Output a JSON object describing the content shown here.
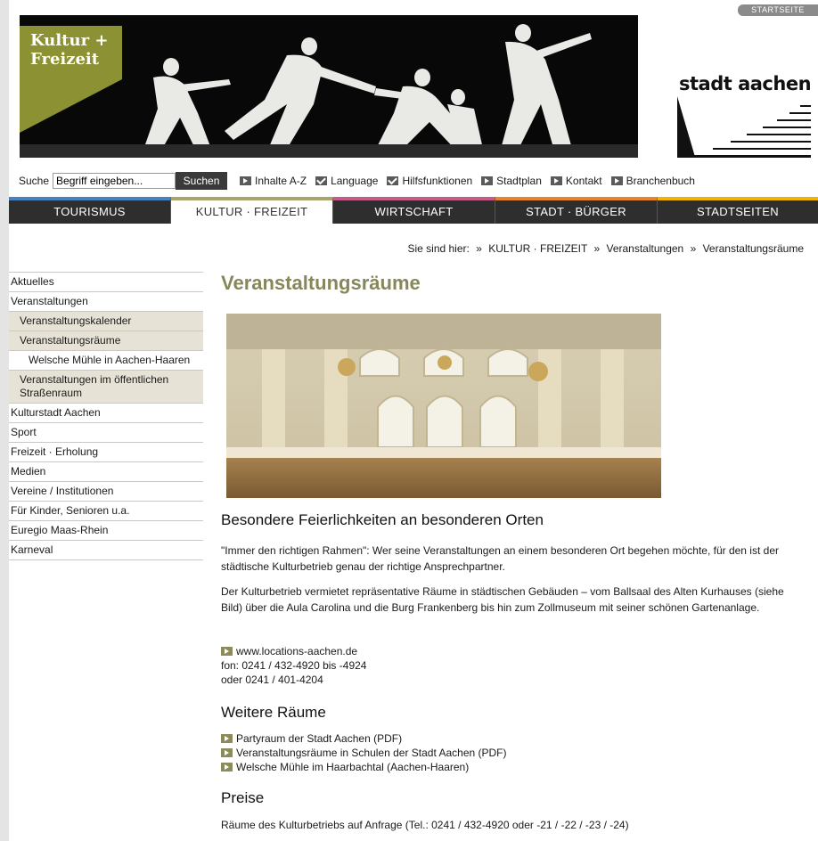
{
  "header": {
    "startseite_label": "STARTSEITE",
    "badge_text_line1": "Kultur +",
    "badge_text_line2": "Freizeit",
    "logo_text": "stadt aachen"
  },
  "toolbar": {
    "search_label": "Suche",
    "search_value": "Begriff eingeben...",
    "search_button": "Suchen",
    "links": [
      {
        "label": "Inhalte A-Z",
        "icon": "arrow-icon"
      },
      {
        "label": "Language",
        "icon": "check-mail-icon"
      },
      {
        "label": "Hilfsfunktionen",
        "icon": "check-mail-icon"
      },
      {
        "label": "Stadtplan",
        "icon": "arrow-icon"
      },
      {
        "label": "Kontakt",
        "icon": "arrow-icon"
      },
      {
        "label": "Branchenbuch",
        "icon": "arrow-icon"
      }
    ]
  },
  "nav": {
    "items": [
      {
        "label": "TOURISMUS",
        "color": "#4a7fc0"
      },
      {
        "label": "KULTUR · FREIZEIT",
        "color": "#a7a66c"
      },
      {
        "label": "WIRTSCHAFT",
        "color": "#c45c88"
      },
      {
        "label": "STADT · BÜRGER",
        "color": "#e8832a"
      },
      {
        "label": "STADTSEITEN",
        "color": "#f0b400"
      }
    ]
  },
  "breadcrumb": {
    "prefix": "Sie sind hier:",
    "items": [
      "KULTUR · FREIZEIT",
      "Veranstaltungen",
      "Veranstaltungsräume"
    ]
  },
  "sidebar": {
    "items": [
      "Aktuelles",
      "Veranstaltungen",
      "Veranstaltungskalender",
      "Veranstaltungsräume",
      "Welsche Mühle in Aachen-Haaren",
      "Veranstaltungen im öffentlichen Straßenraum",
      "Kulturstadt Aachen",
      "Sport",
      "Freizeit · Erholung",
      "Medien",
      "Vereine / Institutionen",
      "Für Kinder, Senioren u.a.",
      "Euregio Maas-Rhein",
      "Karneval"
    ]
  },
  "main": {
    "title": "Veranstaltungsräume",
    "heading1": "Besondere Feierlichkeiten an besonderen Orten",
    "para1": "\"Immer den richtigen Rahmen\": Wer seine Veranstaltungen an einem besonderen Ort begehen möchte, für den ist der städtische Kulturbetrieb genau der richtige Ansprechpartner.",
    "para2": "Der Kulturbetrieb vermietet repräsentative Räume in städtischen Gebäuden – vom Ballsaal des Alten Kurhauses (siehe Bild) über die Aula Carolina und die Burg Frankenberg bis hin zum Zollmuseum mit seiner schönen Gartenanlage.",
    "contact_link": "www.locations-aachen.de",
    "contact_phone1": "fon: 0241 / 432-4920 bis -4924",
    "contact_phone2": "oder 0241 / 401-4204",
    "heading2": "Weitere Räume",
    "more_links": [
      "Partyraum der Stadt Aachen (PDF)",
      "Veranstaltungsräume in Schulen der Stadt Aachen (PDF)",
      "Welsche Mühle im Haarbachtal (Aachen-Haaren)"
    ],
    "heading3": "Preise",
    "price_text": "Räume des Kulturbetriebs auf Anfrage (Tel.: 0241 / 432-4920 oder -21 / -22 / -23 / -24)"
  },
  "colors": {
    "accent_olive": "#86875a",
    "nav_dark": "#2e2e2e"
  }
}
